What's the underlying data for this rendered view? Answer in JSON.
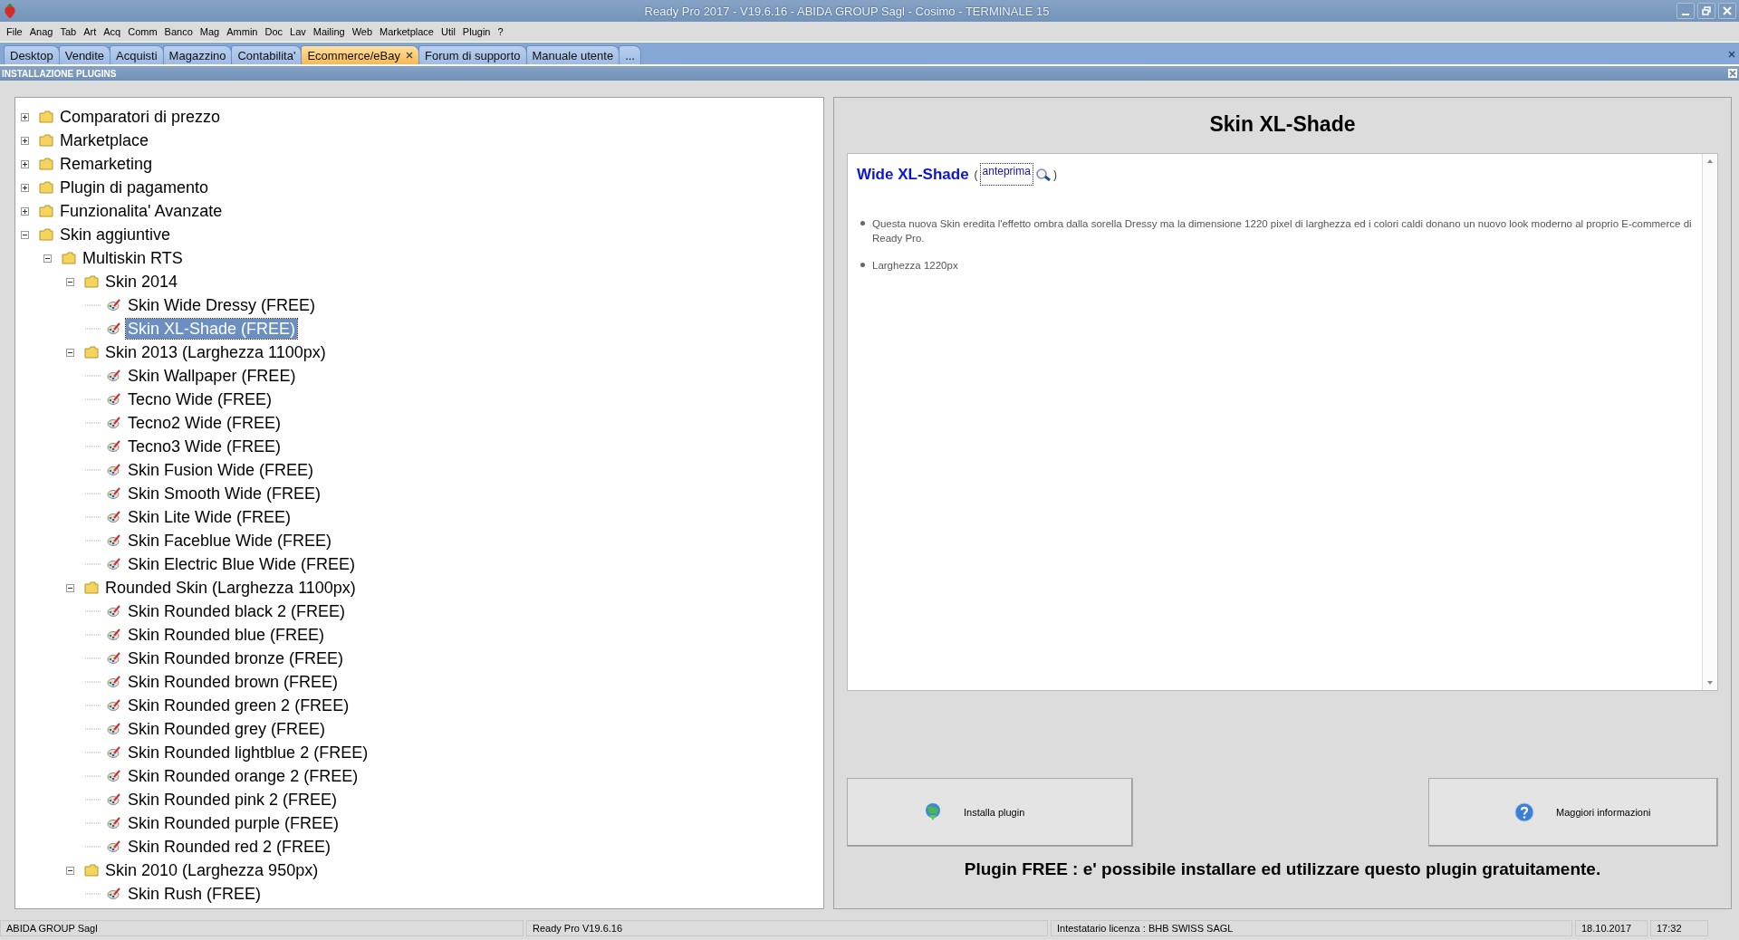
{
  "window": {
    "title": "Ready Pro 2017 - V19.6.16 - ABIDA GROUP Sagl - Cosimo - TERMINALE 15"
  },
  "menu": [
    "File",
    "Anag",
    "Tab",
    "Art",
    "Acq",
    "Comm",
    "Banco",
    "Mag",
    "Ammin",
    "Doc",
    "Lav",
    "Mailing",
    "Web",
    "Marketplace",
    "Util",
    "Plugin",
    "?"
  ],
  "tabs": [
    {
      "label": "Desktop",
      "selected": false
    },
    {
      "label": "Vendite",
      "selected": false
    },
    {
      "label": "Acquisti",
      "selected": false
    },
    {
      "label": "Magazzino",
      "selected": false
    },
    {
      "label": "Contabilita'",
      "selected": false
    },
    {
      "label": "Ecommerce/eBay",
      "selected": true
    },
    {
      "label": "Forum di supporto",
      "selected": false
    },
    {
      "label": "Manuale utente",
      "selected": false
    },
    {
      "label": "...",
      "selected": false
    }
  ],
  "section_title": "INSTALLAZIONE PLUGINS",
  "tree": [
    {
      "label": "Comparatori di prezzo",
      "kind": "folder",
      "expanded": false,
      "selected": false
    },
    {
      "label": "Marketplace",
      "kind": "folder",
      "expanded": false,
      "selected": false
    },
    {
      "label": "Remarketing",
      "kind": "folder",
      "expanded": false,
      "selected": false
    },
    {
      "label": "Plugin di pagamento",
      "kind": "folder",
      "expanded": false,
      "selected": false
    },
    {
      "label": "Funzionalita' Avanzate",
      "kind": "folder",
      "expanded": false,
      "selected": false
    },
    {
      "label": "Skin aggiuntive",
      "kind": "folder",
      "expanded": true,
      "selected": false,
      "children": [
        {
          "label": "Multiskin RTS",
          "kind": "folder",
          "expanded": true,
          "selected": false,
          "children": [
            {
              "label": "Skin 2014",
              "kind": "folder",
              "expanded": true,
              "selected": false,
              "children": [
                {
                  "label": "Skin Wide Dressy (FREE)",
                  "kind": "plugin",
                  "selected": false
                },
                {
                  "label": "Skin XL-Shade (FREE)",
                  "kind": "plugin",
                  "selected": true
                }
              ]
            },
            {
              "label": "Skin 2013 (Larghezza 1100px)",
              "kind": "folder",
              "expanded": true,
              "selected": false,
              "children": [
                {
                  "label": "Skin Wallpaper (FREE)",
                  "kind": "plugin",
                  "selected": false
                },
                {
                  "label": "Tecno Wide (FREE)",
                  "kind": "plugin",
                  "selected": false
                },
                {
                  "label": "Tecno2 Wide (FREE)",
                  "kind": "plugin",
                  "selected": false
                },
                {
                  "label": "Tecno3 Wide (FREE)",
                  "kind": "plugin",
                  "selected": false
                },
                {
                  "label": "Skin Fusion Wide (FREE)",
                  "kind": "plugin",
                  "selected": false
                },
                {
                  "label": "Skin Smooth Wide (FREE)",
                  "kind": "plugin",
                  "selected": false
                },
                {
                  "label": "Skin Lite Wide (FREE)",
                  "kind": "plugin",
                  "selected": false
                },
                {
                  "label": "Skin Faceblue Wide (FREE)",
                  "kind": "plugin",
                  "selected": false
                },
                {
                  "label": "Skin Electric Blue Wide (FREE)",
                  "kind": "plugin",
                  "selected": false
                }
              ]
            },
            {
              "label": "Rounded Skin (Larghezza 1100px)",
              "kind": "folder",
              "expanded": true,
              "selected": false,
              "children": [
                {
                  "label": "Skin Rounded black 2 (FREE)",
                  "kind": "plugin",
                  "selected": false
                },
                {
                  "label": "Skin Rounded blue (FREE)",
                  "kind": "plugin",
                  "selected": false
                },
                {
                  "label": "Skin Rounded bronze (FREE)",
                  "kind": "plugin",
                  "selected": false
                },
                {
                  "label": "Skin Rounded brown (FREE)",
                  "kind": "plugin",
                  "selected": false
                },
                {
                  "label": "Skin Rounded green 2 (FREE)",
                  "kind": "plugin",
                  "selected": false
                },
                {
                  "label": "Skin Rounded grey (FREE)",
                  "kind": "plugin",
                  "selected": false
                },
                {
                  "label": "Skin Rounded lightblue 2 (FREE)",
                  "kind": "plugin",
                  "selected": false
                },
                {
                  "label": "Skin Rounded orange 2 (FREE)",
                  "kind": "plugin",
                  "selected": false
                },
                {
                  "label": "Skin Rounded pink 2 (FREE)",
                  "kind": "plugin",
                  "selected": false
                },
                {
                  "label": "Skin Rounded purple (FREE)",
                  "kind": "plugin",
                  "selected": false
                },
                {
                  "label": "Skin Rounded red 2 (FREE)",
                  "kind": "plugin",
                  "selected": false
                }
              ]
            },
            {
              "label": "Skin 2010 (Larghezza 950px)",
              "kind": "folder",
              "expanded": true,
              "selected": false,
              "children": [
                {
                  "label": "Skin Rush (FREE)",
                  "kind": "plugin",
                  "selected": false
                }
              ]
            }
          ]
        }
      ]
    }
  ],
  "detail": {
    "title": "Skin XL-Shade",
    "name": "Wide XL-Shade",
    "open_paren": "(",
    "preview_link": "anteprima",
    "close_paren": ")",
    "bullets": [
      "Questa nuova Skin eredita l'effetto ombra dalla sorella Dressy ma la dimensione 1220 pixel di larghezza ed i colori caldi donano un nuovo look moderno al proprio E-commerce di Ready Pro.",
      "Larghezza 1220px"
    ],
    "install_button": "Installa plugin",
    "info_button": "Maggiori informazioni",
    "footer": "Plugin FREE : e' possibile installare ed utilizzare questo plugin gratuitamente."
  },
  "status_bar": [
    "ABIDA GROUP Sagl",
    "Ready Pro V19.6.16",
    "Intestatario licenza : BHB SWISS SAGL",
    "18.10.2017",
    "17:32"
  ]
}
